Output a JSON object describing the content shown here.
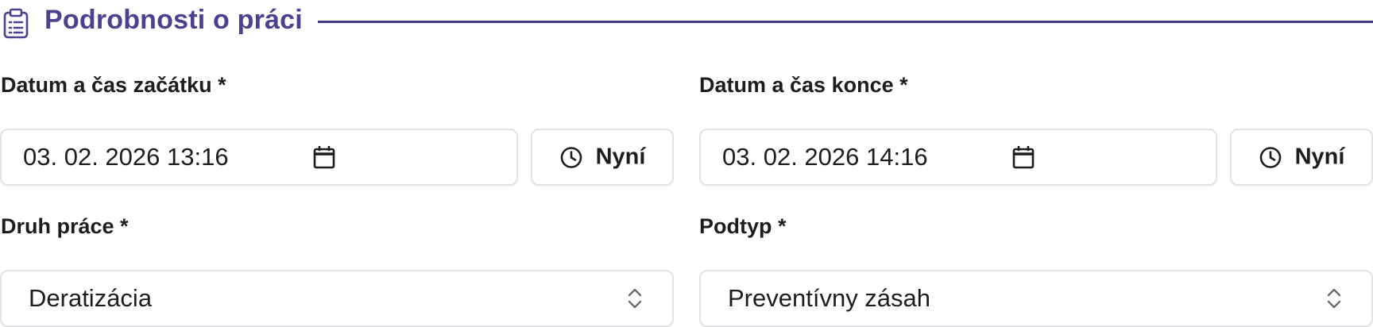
{
  "section": {
    "title": "Podrobnosti o práci",
    "icon": "clipboard-list-icon",
    "accent_color": "#4f3f8f"
  },
  "start": {
    "label": "Datum a čas začátku *",
    "value": "03. 02. 2026 13:16",
    "now_label": "Nyní"
  },
  "end": {
    "label": "Datum a čas konce *",
    "value": "03. 02. 2026 14:16",
    "now_label": "Nyní"
  },
  "work_type": {
    "label": "Druh práce *",
    "selected": "Deratizácia"
  },
  "subtype": {
    "label": "Podtyp *",
    "selected": "Preventívny zásah"
  }
}
